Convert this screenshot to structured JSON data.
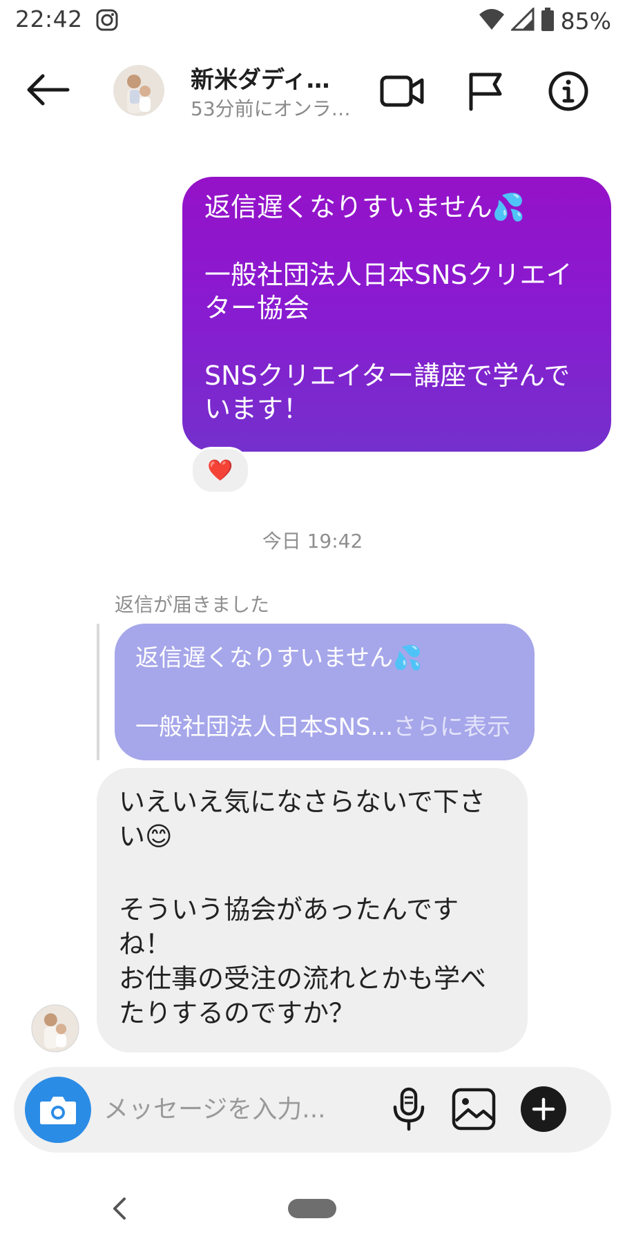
{
  "status_bar": {
    "time": "22:42",
    "battery": "85%",
    "icons": [
      "instagram-icon",
      "wifi-icon",
      "signal-icon",
      "battery-icon"
    ]
  },
  "header": {
    "contact_name": "新米ダディ…",
    "contact_status": "53分前にオンラ…",
    "icons": [
      "back-arrow-icon",
      "video-call-icon",
      "flag-icon",
      "info-icon"
    ]
  },
  "conversation": {
    "sent_message": {
      "lines": [
        "返信遅くなりすいません💦",
        "一般社団法人日本SNSクリエイター協会",
        "SNSクリエイター講座で学んでいます！"
      ],
      "reaction": "❤️"
    },
    "date_separator": "今日 19:42",
    "reply_label": "返信が届きました",
    "reply_preview": {
      "line1": "返信遅くなりすいません💦",
      "line2": "一般社団法人日本SNS...",
      "more": "さらに表示"
    },
    "received_message": {
      "lines": [
        "いえいえ気になさらないで下さい😊",
        "そういう協会があったんですね！",
        "お仕事の受注の流れとかも学べたりするのですか？"
      ]
    }
  },
  "composer": {
    "placeholder": "メッセージを入力...",
    "icons": [
      "camera-icon",
      "microphone-icon",
      "gallery-icon",
      "plus-icon"
    ]
  },
  "colors": {
    "sent_bubble_top": "#9512c8",
    "sent_bubble_bottom": "#7430cc",
    "reply_preview": "#a6a6ea",
    "received_bubble": "#efefef",
    "camera_button": "#2b8ce6"
  }
}
